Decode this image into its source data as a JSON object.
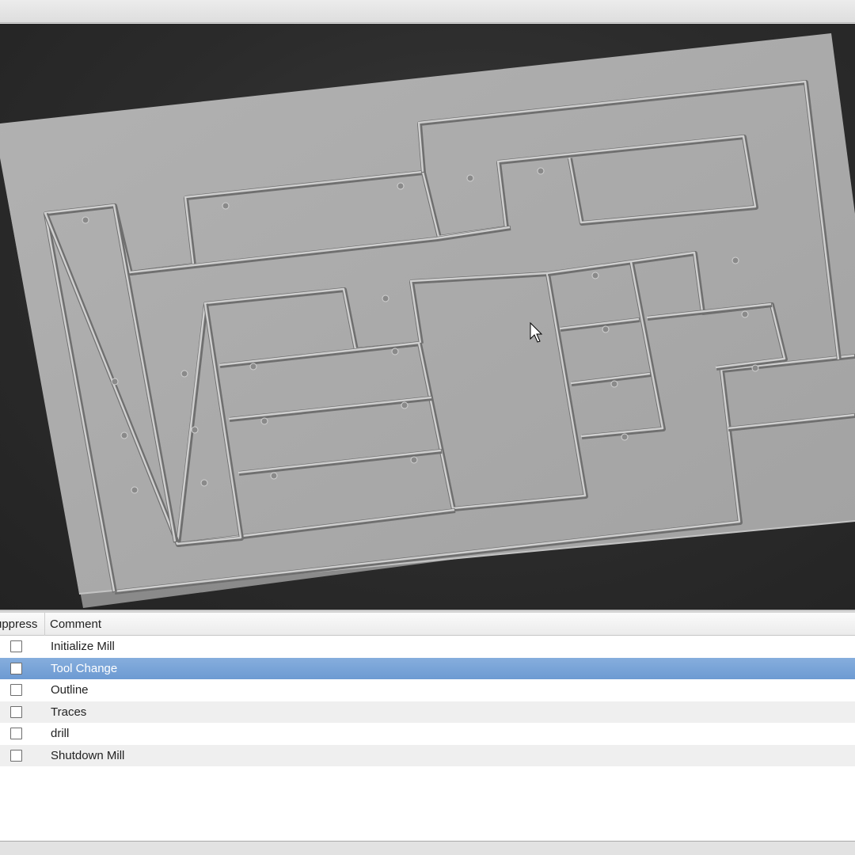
{
  "table": {
    "columns": {
      "suppress": "uppress",
      "comment": "Comment"
    },
    "rows": [
      {
        "comment": "Initialize Mill",
        "suppressed": false,
        "selected": false
      },
      {
        "comment": "Tool Change",
        "suppressed": false,
        "selected": true
      },
      {
        "comment": "Outline",
        "suppressed": false,
        "selected": false
      },
      {
        "comment": "Traces",
        "suppressed": false,
        "selected": false
      },
      {
        "comment": "drill",
        "suppressed": false,
        "selected": false
      },
      {
        "comment": "Shutdown Mill",
        "suppressed": false,
        "selected": false
      }
    ]
  },
  "viewport": {
    "background_color": "#2b2b2b",
    "board_color": "#a8a8a8",
    "cursor_icon": "arrow-cursor-icon"
  },
  "selection_color": "#7ba4d8"
}
